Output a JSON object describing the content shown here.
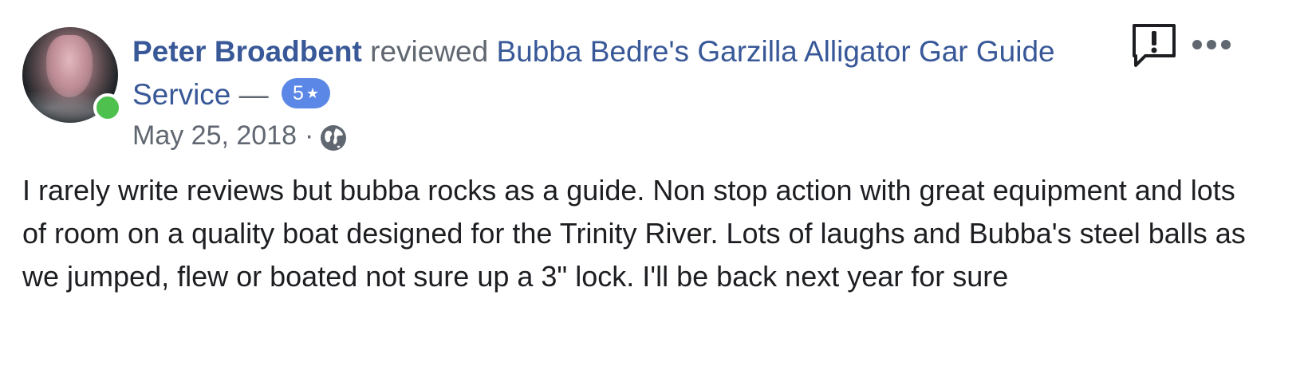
{
  "review": {
    "author": "Peter Broadbent",
    "verb": "reviewed",
    "page_name": "Bubba Bedre's Garzilla Alligator Gar Guide Service",
    "dash": "—",
    "rating": "5",
    "star_glyph": "★",
    "date": "May 25, 2018",
    "meta_separator": "·",
    "privacy_icon": "globe-icon",
    "body": "I rarely write reviews but bubba rocks as a guide. Non stop action with great equipment and lots of room on a quality boat designed for the Trinity River. Lots of laughs and Bubba's steel balls as we jumped, flew or boated not sure up a 3\" lock. I'll be back next year for sure"
  },
  "avatar": {
    "online": true,
    "online_color": "#4ec04e"
  },
  "actions": {
    "report_icon": "report-icon",
    "more_icon": "more-options-icon"
  },
  "colors": {
    "link": "#385898",
    "secondary_text": "#606770",
    "body_text": "#1c1e21",
    "badge": "#5b87e6"
  }
}
